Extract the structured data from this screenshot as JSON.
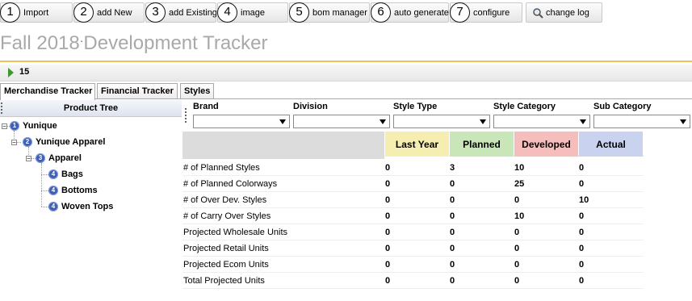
{
  "toolbar": {
    "buttons": [
      {
        "num": "1",
        "label": "Import"
      },
      {
        "num": "2",
        "label": "add New"
      },
      {
        "num": "3",
        "label": "add Existing"
      },
      {
        "num": "4",
        "label": "image"
      },
      {
        "num": "5",
        "label": "bom manager"
      },
      {
        "num": "6",
        "label": "auto generate"
      },
      {
        "num": "7",
        "label": "configure"
      }
    ],
    "changelog_label": "change log",
    "changelog_icon": "magnifier-icon"
  },
  "page_title": "Fall 2018",
  "page_title_dot": "·",
  "page_title_rest": "Development Tracker",
  "subbar": {
    "count": "15"
  },
  "tabs": [
    "Merchandise Tracker",
    "Financial Tracker",
    "Styles"
  ],
  "tree": {
    "header": "Product Tree",
    "nodes": [
      {
        "level": "1",
        "label": "Yunique"
      },
      {
        "level": "2",
        "label": "Yunique Apparel"
      },
      {
        "level": "3",
        "label": "Apparel"
      },
      {
        "level": "4",
        "label": "Bags"
      },
      {
        "level": "4",
        "label": "Bottoms"
      },
      {
        "level": "4",
        "label": "Woven Tops"
      }
    ]
  },
  "filters": [
    "Brand",
    "Division",
    "Style Type",
    "Style Category",
    "Sub Category"
  ],
  "grid": {
    "columns": [
      {
        "label": "Last Year",
        "color": "#f5eeb0"
      },
      {
        "label": "Planned",
        "color": "#c8e6b8"
      },
      {
        "label": "Developed",
        "color": "#f6bdbd"
      },
      {
        "label": "Actual",
        "color": "#c9d2ee"
      }
    ],
    "rows": [
      {
        "label": "# of Planned Styles",
        "values": [
          "0",
          "3",
          "10",
          "0"
        ]
      },
      {
        "label": "# of Planned Colorways",
        "values": [
          "0",
          "0",
          "25",
          "0"
        ]
      },
      {
        "label": "# of Over Dev. Styles",
        "values": [
          "0",
          "0",
          "0",
          "10"
        ]
      },
      {
        "label": "# of Carry Over Styles",
        "values": [
          "0",
          "0",
          "10",
          "0"
        ]
      },
      {
        "label": "Projected Wholesale Units",
        "values": [
          "0",
          "0",
          "0",
          "0"
        ]
      },
      {
        "label": "Projected Retail Units",
        "values": [
          "0",
          "0",
          "0",
          "0"
        ]
      },
      {
        "label": "Projected Ecom Units",
        "values": [
          "0",
          "0",
          "0",
          "0"
        ]
      },
      {
        "label": "Total Projected Units",
        "values": [
          "0",
          "0",
          "0",
          "0"
        ]
      }
    ]
  }
}
